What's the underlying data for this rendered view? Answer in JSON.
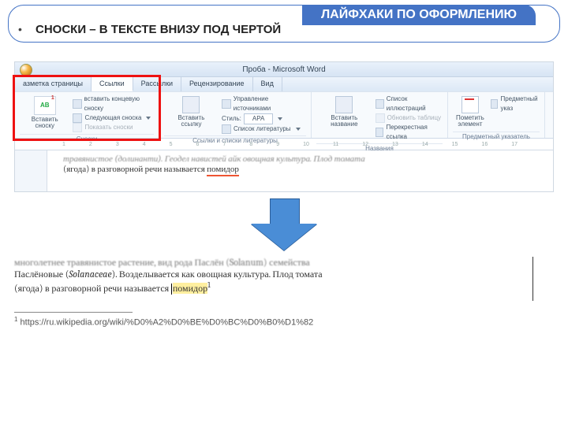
{
  "header": {
    "band": "ЛАЙФХАКИ ПО ОФОРМЛЕНИЮ",
    "bullet": "•",
    "sub": "СНОСКИ – В ТЕКСТЕ ВНИЗУ ПОД ЧЕРТОЙ"
  },
  "app": {
    "title": "Проба - Microsoft Word"
  },
  "tabs": [
    "азметка страницы",
    "Ссылки",
    "Рассылки",
    "Рецензирование",
    "Вид"
  ],
  "ribbon": {
    "g1": {
      "big": "Вставить\nсноску",
      "ab": "AB",
      "sup": "1",
      "l1": "вставить концевую сноску",
      "l2": "Следующая сноска",
      "l3": "Показать сноски",
      "label": "Сноски"
    },
    "g2": {
      "big": "Вставить\nссылку",
      "l1": "Управление источниками",
      "stylelab": "Стиль:",
      "style": "APA",
      "l3": "Список литературы",
      "label": "Ссылки и списки литературы"
    },
    "g3": {
      "big": "Вставить\nназвание",
      "l1": "Список иллюстраций",
      "l2": "Обновить таблицу",
      "l3": "Перекрестная ссылка",
      "label": "Названия"
    },
    "g4": {
      "big": "Пометить\nэлемент",
      "l1": "Предметный указ",
      "label": "Предметный указатель"
    }
  },
  "ruler": [
    "1",
    "2",
    "3",
    "4",
    "5",
    "6",
    "7",
    "8",
    "9",
    "10",
    "11",
    "12",
    "13",
    "14",
    "15",
    "16",
    "17"
  ],
  "before": {
    "blur": "травянистое (долинанти). Геодел навистей айк овощная культура. Плод томата",
    "line": "(ягода) в разговорной речи называется ",
    "word": "помидор"
  },
  "after": {
    "blur1": "многолетнее травянистое растение, вид рода Паслён (Solanum) семейства",
    "line2a": "Паслёновые (",
    "ital": "Solanaceae",
    "line2b": "). Возделывается как овощная культура. Плод томата",
    "line3a": "(ягода) в разговорной речи называется ",
    "hl": "помидор",
    "sup": "1"
  },
  "footnote": {
    "sup": "1",
    "text": "https://ru.wikipedia.org/wiki/%D0%A2%D0%BE%D0%BC%D0%B0%D1%82"
  }
}
